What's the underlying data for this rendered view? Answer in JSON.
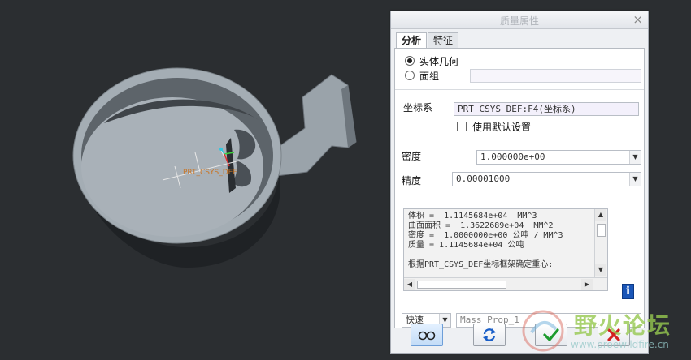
{
  "viewport": {
    "csys_label": "PRT_CSYS_DEF"
  },
  "dialog": {
    "title": "质量属性",
    "close_symbol": "×",
    "tabs": [
      {
        "label": "分析",
        "active": true
      },
      {
        "label": "特征",
        "active": false
      }
    ],
    "geometry": {
      "options": [
        {
          "label": "实体几何",
          "selected": true
        },
        {
          "label": "面组",
          "selected": false
        }
      ],
      "quilt_field_value": ""
    },
    "csys": {
      "label": "坐标系",
      "value": "PRT_CSYS_DEF:F4(坐标系)",
      "use_default_label": "使用默认设置",
      "use_default_checked": false
    },
    "density": {
      "label": "密度",
      "value": "1.000000e+00"
    },
    "accuracy": {
      "label": "精度",
      "value": "0.00001000"
    },
    "results": {
      "lines": [
        "体积 =  1.1145684e+04  MM^3",
        "曲面面积 =  1.3622689e+04  MM^2",
        "密度 =  1.0000000e+00 公吨 / MM^3",
        "质量 = 1.1145684e+04 公吨",
        "",
        "根据PRT_CSYS_DEF坐标框架确定重心:"
      ]
    },
    "info_icon": "i",
    "mode": {
      "value": "快速",
      "name_value": "Mass_Prop_1"
    }
  },
  "watermark": {
    "title": "野火论坛",
    "url": "www.proewildfire.cn"
  },
  "colors": {
    "background": "#2b2e31",
    "model": "#a4adb4",
    "accent_blue": "#1a56b8"
  }
}
